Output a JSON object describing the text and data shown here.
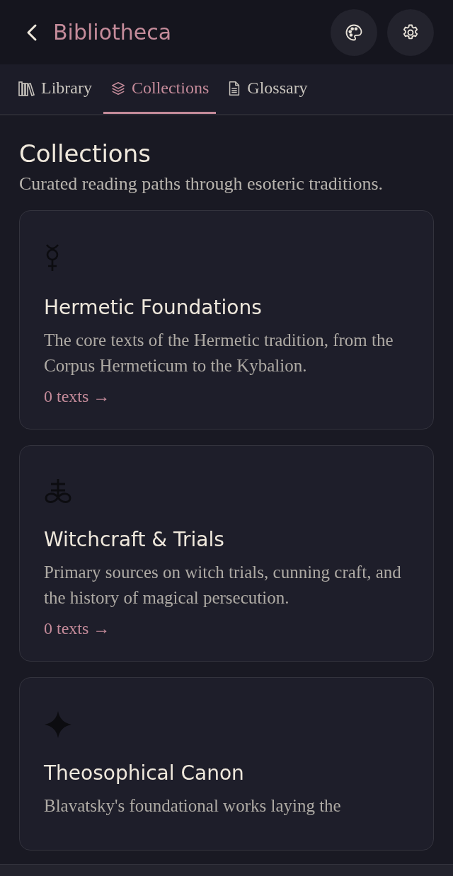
{
  "header": {
    "title": "Bibliotheca"
  },
  "tabs": [
    {
      "label": "Library",
      "kind": "books",
      "selected": false
    },
    {
      "label": "Collections",
      "kind": "layers",
      "selected": true
    },
    {
      "label": "Glossary",
      "kind": "document",
      "selected": false
    }
  ],
  "page": {
    "title": "Collections",
    "subtitle": "Curated reading paths through esoteric traditions."
  },
  "collections": [
    {
      "kind": "mercury",
      "title": "Hermetic Foundations",
      "description": "The core texts of the Hermetic tradition, from the Corpus Hermeticum to the Kybalion.",
      "count": "0 texts →"
    },
    {
      "kind": "sulfur",
      "title": "Witchcraft & Trials",
      "description": "Primary sources on witch trials, cunning craft, and the history of magical persecution.",
      "count": "0 texts →"
    },
    {
      "kind": "star",
      "title": "Theosophical Canon",
      "description": "Blavatsky's foundational works laying the"
    }
  ]
}
